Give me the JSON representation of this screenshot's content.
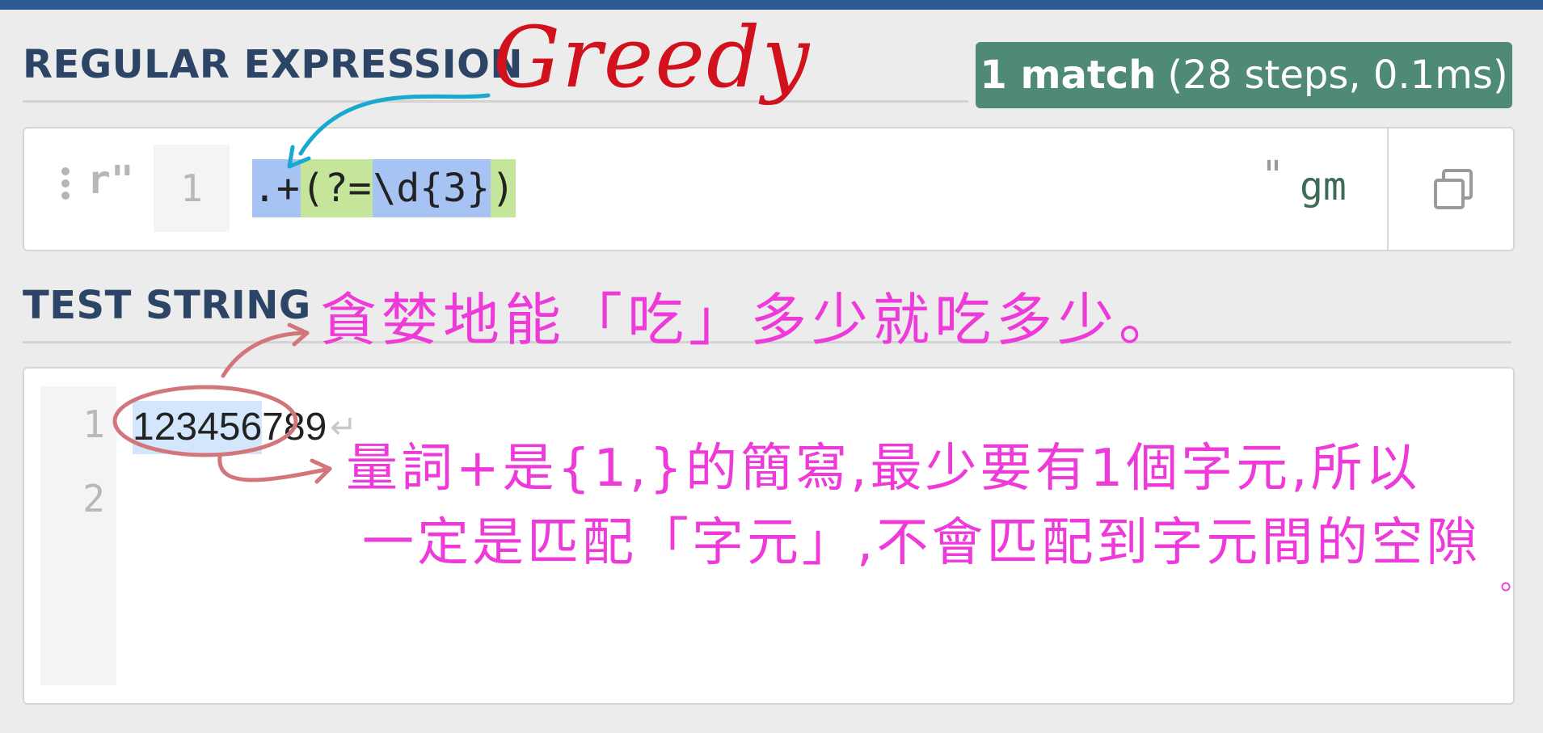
{
  "regex_section": {
    "title": "REGULAR EXPRESSION",
    "match_summary": {
      "count": "1 match",
      "details": "(28 steps, 0.1ms)"
    },
    "delimiter_open": "r\"",
    "line_number": "1",
    "tokens": [
      {
        "text": ".+",
        "style": "blue"
      },
      {
        "text": "(?=",
        "style": "green"
      },
      {
        "text": "\\d{3}",
        "style": "blue"
      },
      {
        "text": ")",
        "style": "green"
      }
    ],
    "delimiter_close": "\"",
    "flags": "gm"
  },
  "test_section": {
    "title": "TEST STRING",
    "line_numbers": [
      "1",
      "2"
    ],
    "line1_matched": "123456",
    "line1_rest": "789",
    "newline_symbol": "↵"
  },
  "annotations": {
    "greedy": "Greedy",
    "note1": "貪婪地能「吃」多少就吃多少。",
    "note2": "量詞+是{1,}的簡寫,最少要有1個字元,所以",
    "note3": "一定是匹配「字元」,不會匹配到字元間的空隙",
    "note3_end": "。"
  },
  "colors": {
    "topbar": "#2d5b96",
    "badge": "#4f8a74",
    "token_blue": "#a6c3f3",
    "token_green": "#c4e59a",
    "match_highlight": "#d3e6fb",
    "ink_red": "#d1111c",
    "ink_pink": "#ee3ad9",
    "ink_cyan": "#19a8cf",
    "ink_rose": "#d3767c"
  }
}
